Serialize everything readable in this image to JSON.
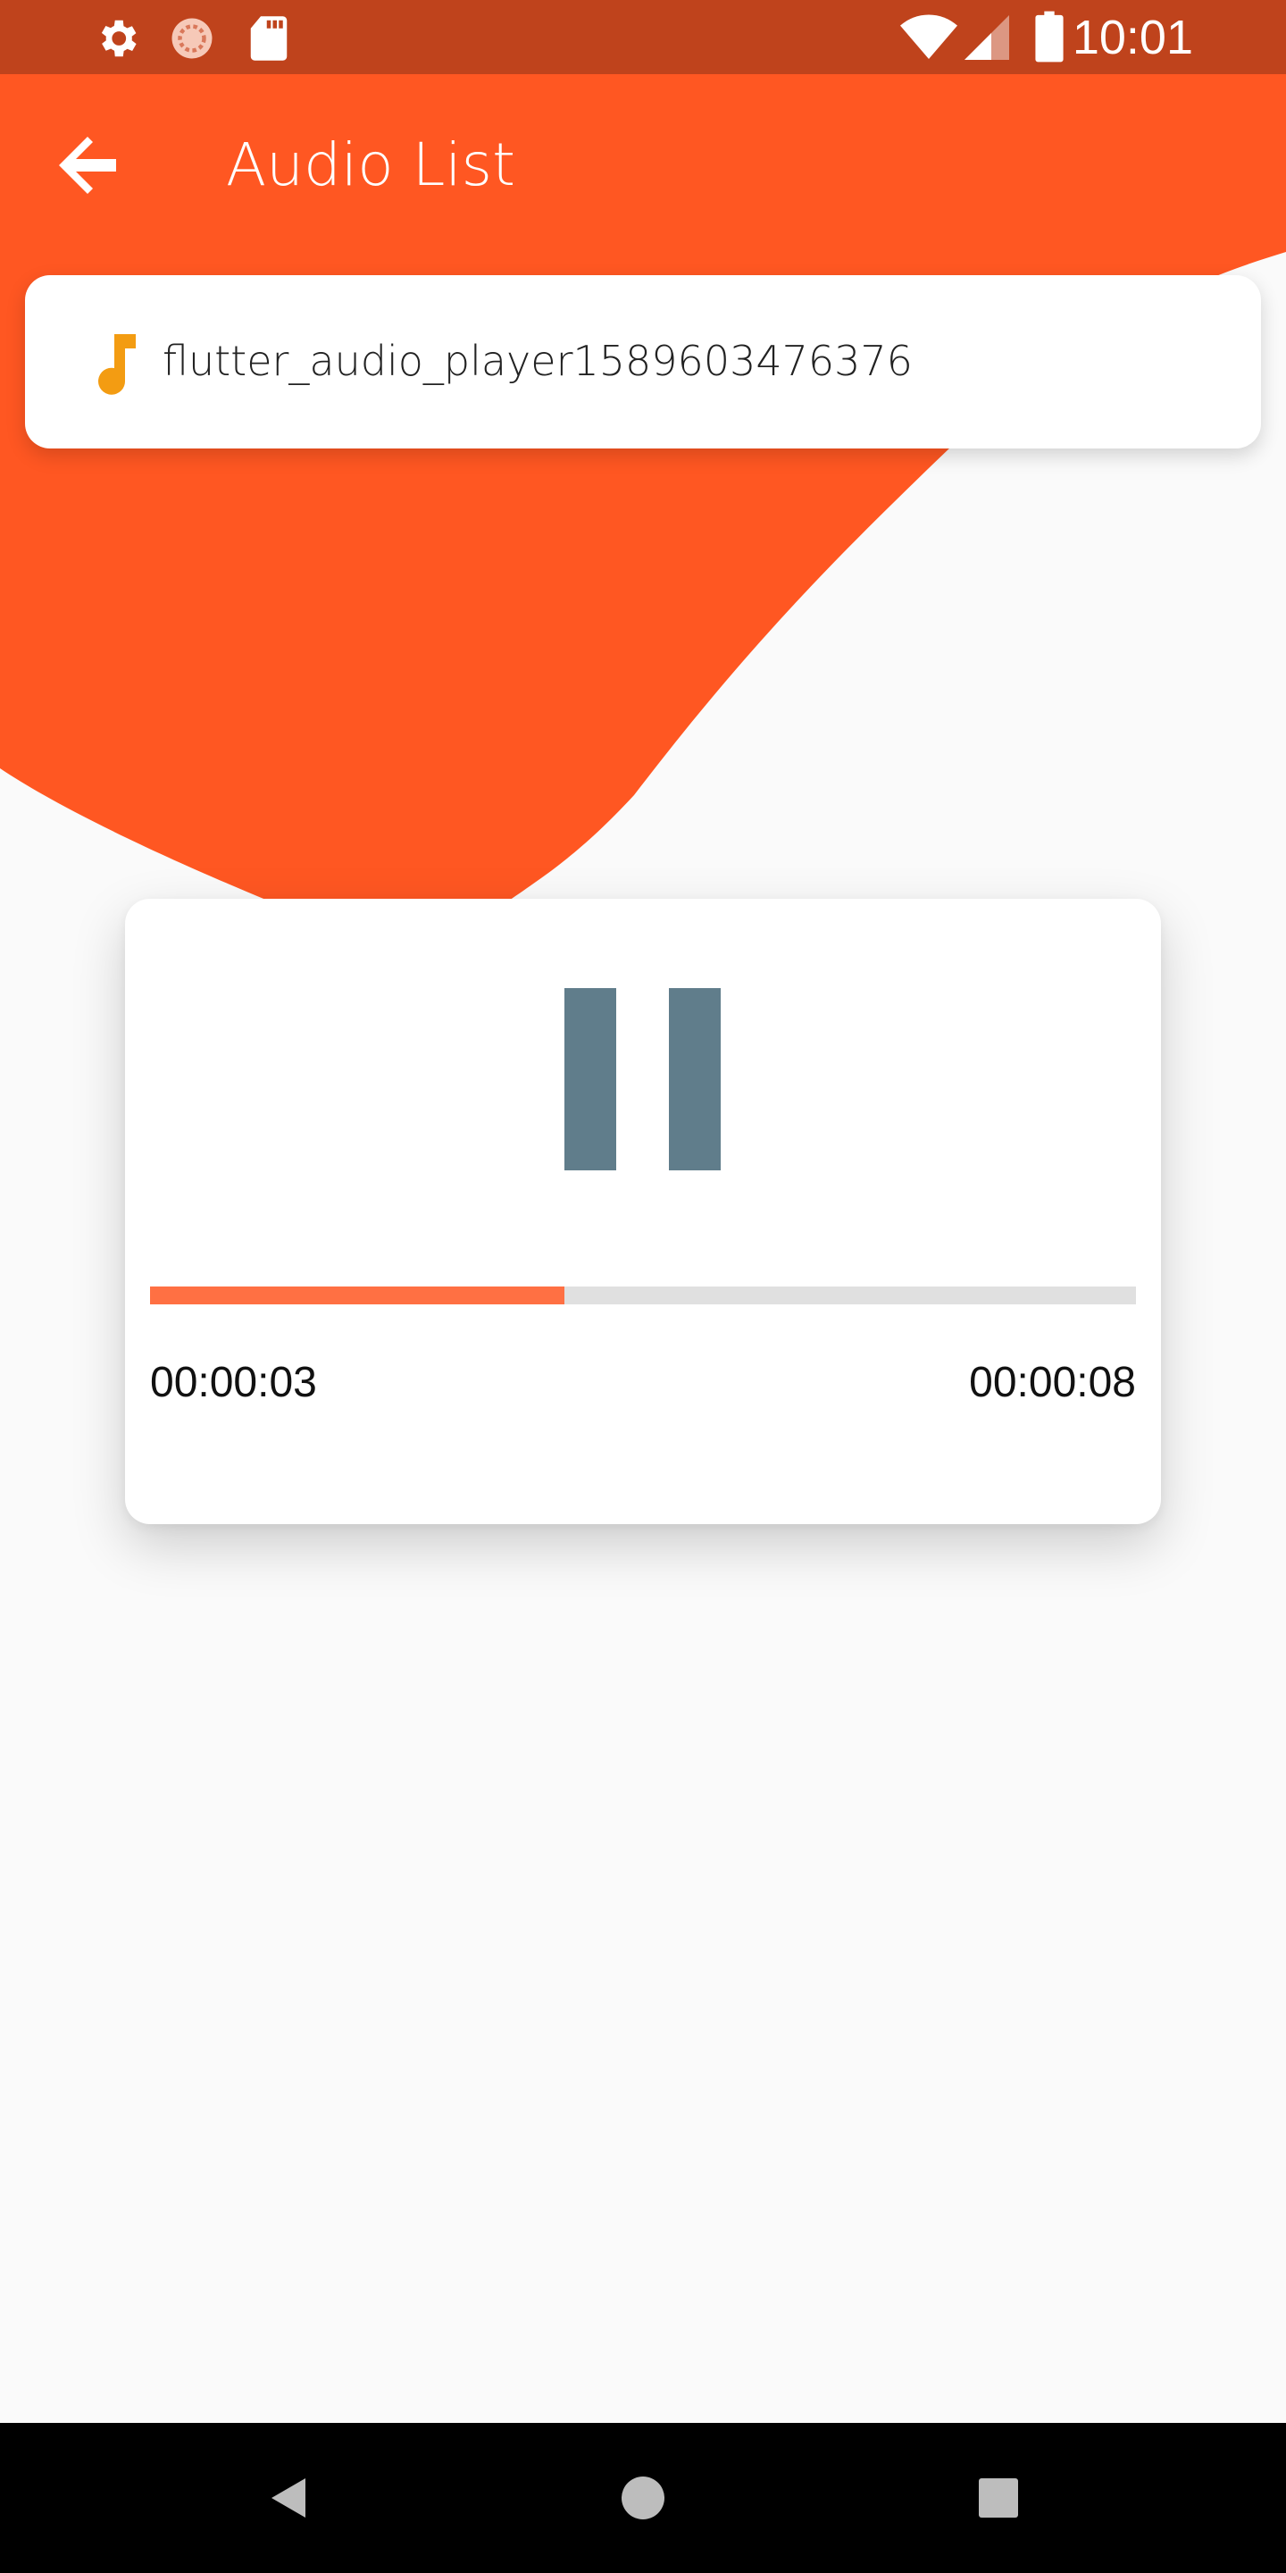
{
  "colors": {
    "accent": "#ff5722",
    "status_bar": "#bf431c",
    "note_icon": "#f39c12",
    "pause_icon": "#607d8b",
    "progress_fill": "#ff7043",
    "progress_track": "#e0e0e0",
    "background": "#fafafa"
  },
  "status_bar": {
    "time": "10:01",
    "icons": [
      "settings-icon",
      "sync-icon",
      "sd-card-icon",
      "wifi-icon",
      "signal-icon",
      "battery-icon"
    ]
  },
  "app_bar": {
    "title": "Audio List",
    "back_icon": "arrow-back-icon"
  },
  "audio_list": [
    {
      "icon": "music-note-icon",
      "title": "flutter_audio_player1589603476376"
    }
  ],
  "player": {
    "state_icon": "pause-icon",
    "progress": 0.42,
    "elapsed": "00:00:03",
    "duration": "00:00:08"
  },
  "nav_bar": {
    "buttons": [
      "back-triangle-icon",
      "home-circle-icon",
      "recents-square-icon"
    ]
  }
}
